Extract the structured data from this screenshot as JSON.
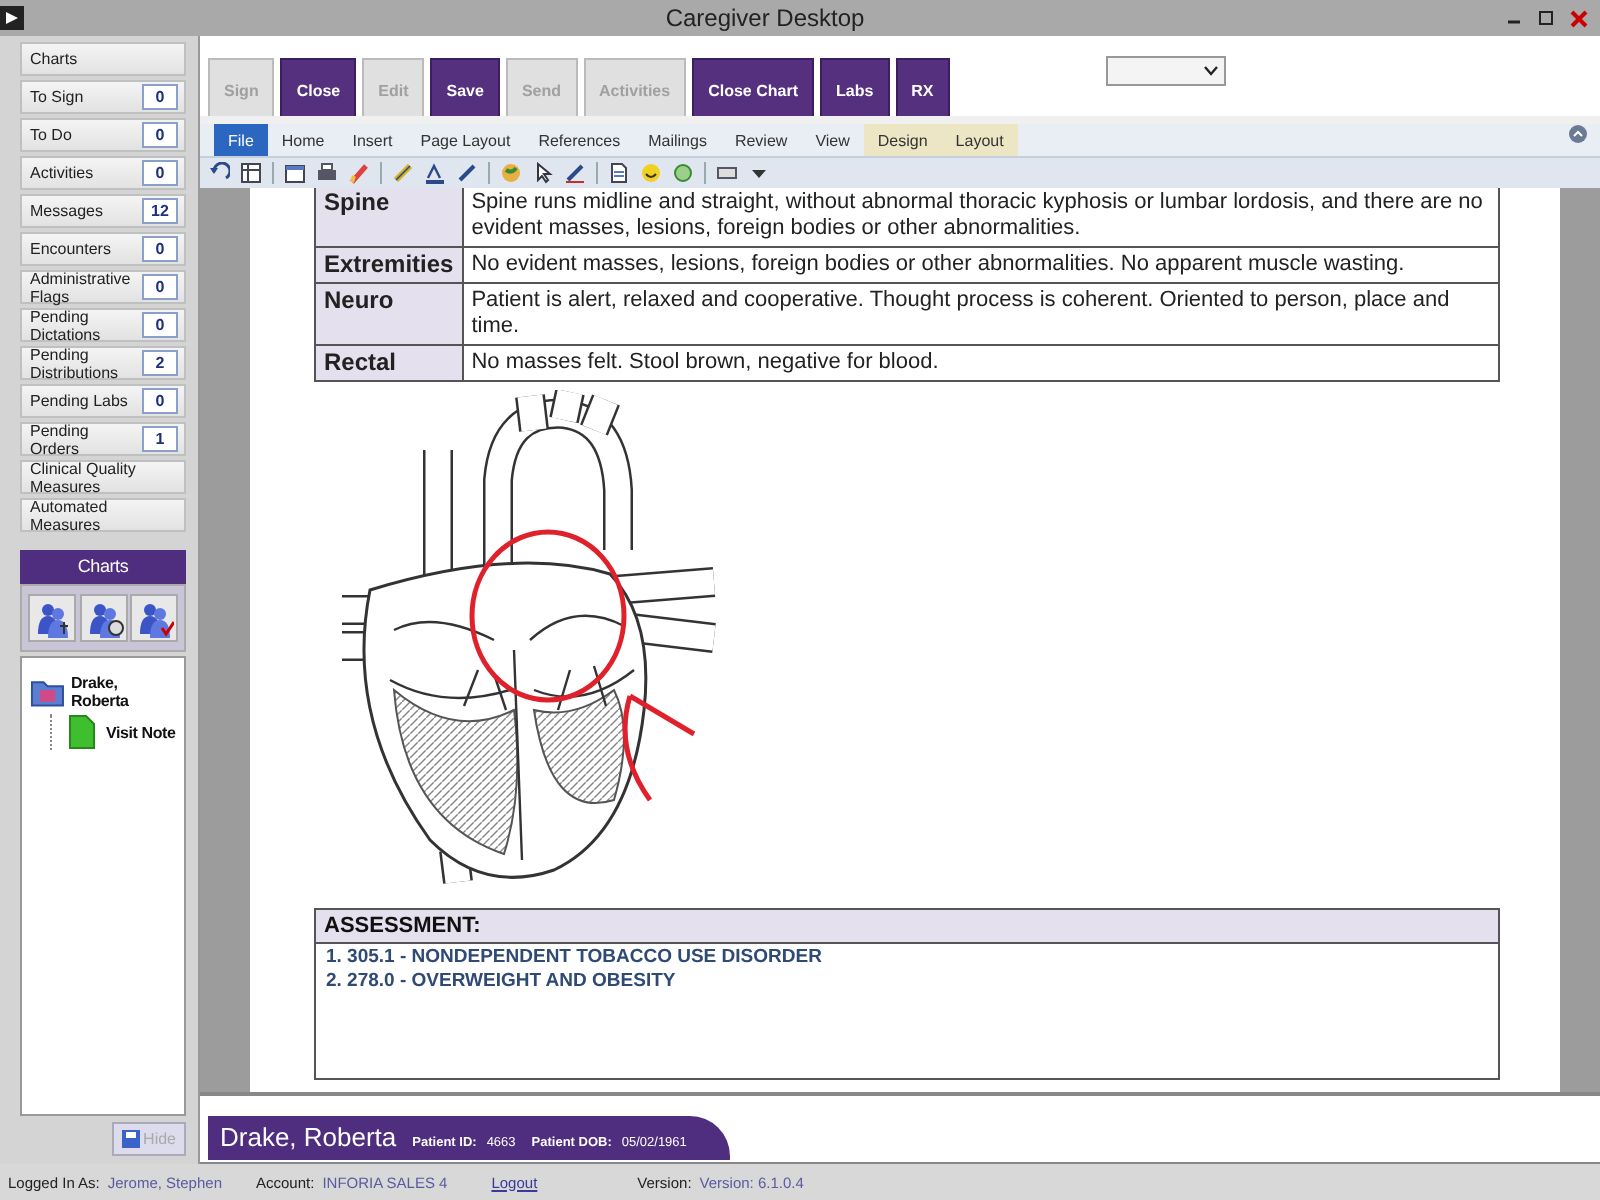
{
  "window": {
    "title": "Caregiver Desktop"
  },
  "sidebar": {
    "items": [
      {
        "label": "Charts"
      },
      {
        "label": "To Sign",
        "count": "0"
      },
      {
        "label": "To Do",
        "count": "0"
      },
      {
        "label": "Activities",
        "count": "0"
      },
      {
        "label": "Messages",
        "count": "12"
      },
      {
        "label": "Encounters",
        "count": "0"
      },
      {
        "label": "Administrative Flags",
        "count": "0"
      },
      {
        "label": "Pending Dictations",
        "count": "0"
      },
      {
        "label": "Pending Distributions",
        "count": "2"
      },
      {
        "label": "Pending Labs",
        "count": "0"
      },
      {
        "label": "Pending Orders",
        "count": "1"
      },
      {
        "label": "Clinical Quality Measures"
      },
      {
        "label": "Automated Measures"
      }
    ],
    "charts_panel": {
      "title": "Charts",
      "tree": [
        {
          "label": "Drake, Roberta",
          "kind": "patient",
          "children": [
            {
              "label": "Visit Note",
              "kind": "note"
            }
          ]
        }
      ]
    },
    "hide_button": {
      "label": "Hide",
      "disabled": true
    }
  },
  "toolbar": {
    "buttons": [
      {
        "label": "Sign",
        "disabled": true
      },
      {
        "label": "Close",
        "disabled": false
      },
      {
        "label": "Edit",
        "disabled": true
      },
      {
        "label": "Save",
        "disabled": false
      },
      {
        "label": "Send",
        "disabled": true
      },
      {
        "label": "Activities",
        "disabled": true
      },
      {
        "label": "Close Chart",
        "disabled": false
      },
      {
        "label": "Labs",
        "disabled": false
      },
      {
        "label": "RX",
        "disabled": false
      }
    ]
  },
  "ribbon": {
    "tabs": [
      {
        "label": "File",
        "kind": "file"
      },
      {
        "label": "Home",
        "kind": "tab"
      },
      {
        "label": "Insert",
        "kind": "tab"
      },
      {
        "label": "Page Layout",
        "kind": "tab"
      },
      {
        "label": "References",
        "kind": "tab"
      },
      {
        "label": "Mailings",
        "kind": "tab"
      },
      {
        "label": "Review",
        "kind": "tab"
      },
      {
        "label": "View",
        "kind": "tab"
      },
      {
        "label": "Design",
        "kind": "contextual"
      },
      {
        "label": "Layout",
        "kind": "contextual"
      }
    ]
  },
  "document": {
    "exam_rows": [
      {
        "label": "Spine",
        "text": "Spine runs midline and straight, without abnormal thoracic kyphosis or lumbar lordosis, and there are no evident masses, lesions, foreign bodies or other abnormalities."
      },
      {
        "label": "Extremities",
        "text": "No evident masses, lesions, foreign bodies or other abnormalities. No apparent muscle wasting."
      },
      {
        "label": "Neuro",
        "text": "Patient is alert, relaxed and cooperative. Thought process is coherent. Oriented to person, place and time."
      },
      {
        "label": "Rectal",
        "text": "No masses felt.  Stool brown, negative for blood."
      }
    ],
    "assessment": {
      "title": "ASSESSMENT:",
      "items": [
        "1. 305.1 - NONDEPENDENT TOBACCO USE DISORDER",
        "2. 278.0 - OVERWEIGHT AND OBESITY"
      ]
    }
  },
  "patient_bar": {
    "name": "Drake, Roberta",
    "id_label": "Patient ID:",
    "id": "4663",
    "dob_label": "Patient DOB:",
    "dob": "05/02/1961"
  },
  "status_bar": {
    "logged_in_label": "Logged In As:",
    "user": "Jerome, Stephen",
    "account_label": "Account:",
    "account": "INFORIA SALES 4",
    "logout": "Logout",
    "version_label": "Version:",
    "version": "Version: 6.1.0.4"
  }
}
